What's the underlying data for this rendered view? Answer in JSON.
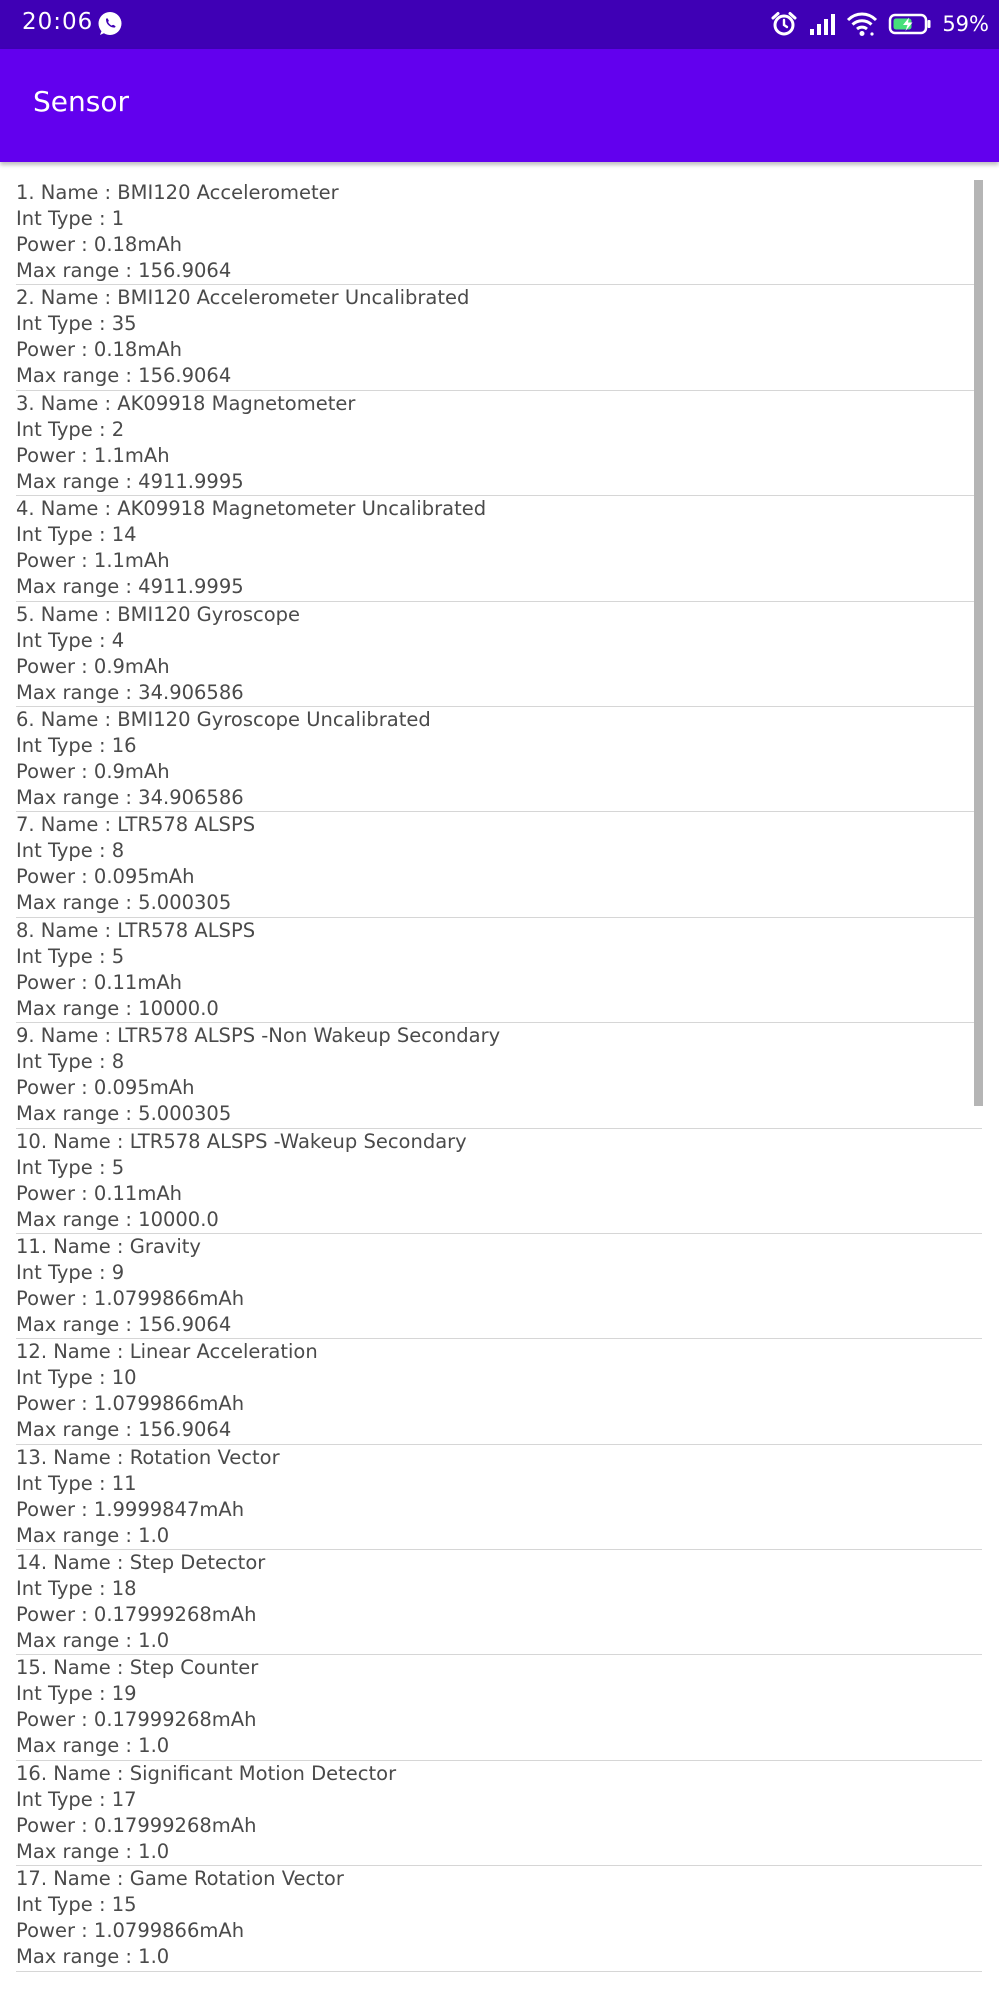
{
  "status_bar": {
    "time": "20:06",
    "battery_percent": "59%"
  },
  "app_bar": {
    "title": "Sensor"
  },
  "sensors": [
    {
      "index": "1",
      "name": "BMI120 Accelerometer",
      "int_type": "1",
      "power": "0.18mAh",
      "max_range": "156.9064"
    },
    {
      "index": "2",
      "name": "BMI120 Accelerometer Uncalibrated",
      "int_type": "35",
      "power": "0.18mAh",
      "max_range": "156.9064"
    },
    {
      "index": "3",
      "name": "AK09918 Magnetometer",
      "int_type": "2",
      "power": "1.1mAh",
      "max_range": "4911.9995"
    },
    {
      "index": "4",
      "name": "AK09918 Magnetometer Uncalibrated",
      "int_type": "14",
      "power": "1.1mAh",
      "max_range": "4911.9995"
    },
    {
      "index": "5",
      "name": "BMI120 Gyroscope",
      "int_type": "4",
      "power": "0.9mAh",
      "max_range": "34.906586"
    },
    {
      "index": "6",
      "name": "BMI120 Gyroscope Uncalibrated",
      "int_type": "16",
      "power": "0.9mAh",
      "max_range": "34.906586"
    },
    {
      "index": "7",
      "name": "LTR578 ALSPS",
      "int_type": "8",
      "power": "0.095mAh",
      "max_range": "5.000305"
    },
    {
      "index": "8",
      "name": "LTR578 ALSPS",
      "int_type": "5",
      "power": "0.11mAh",
      "max_range": "10000.0"
    },
    {
      "index": "9",
      "name": "LTR578 ALSPS -Non Wakeup Secondary",
      "int_type": "8",
      "power": "0.095mAh",
      "max_range": "5.000305"
    },
    {
      "index": "10",
      "name": "LTR578 ALSPS -Wakeup Secondary",
      "int_type": "5",
      "power": "0.11mAh",
      "max_range": "10000.0"
    },
    {
      "index": "11",
      "name": "Gravity",
      "int_type": "9",
      "power": "1.0799866mAh",
      "max_range": "156.9064"
    },
    {
      "index": "12",
      "name": "Linear Acceleration",
      "int_type": "10",
      "power": "1.0799866mAh",
      "max_range": "156.9064"
    },
    {
      "index": "13",
      "name": "Rotation Vector",
      "int_type": "11",
      "power": "1.9999847mAh",
      "max_range": "1.0"
    },
    {
      "index": "14",
      "name": "Step Detector",
      "int_type": "18",
      "power": "0.17999268mAh",
      "max_range": "1.0"
    },
    {
      "index": "15",
      "name": "Step Counter",
      "int_type": "19",
      "power": "0.17999268mAh",
      "max_range": "1.0"
    },
    {
      "index": "16",
      "name": "Significant Motion Detector",
      "int_type": "17",
      "power": "0.17999268mAh",
      "max_range": "1.0"
    },
    {
      "index": "17",
      "name": "Game Rotation Vector",
      "int_type": "15",
      "power": "1.0799866mAh",
      "max_range": "1.0"
    }
  ],
  "colors": {
    "status_bar": "#3f00b5",
    "app_bar": "#6200ee",
    "text": "#4a4a4a",
    "divider": "#d6d6d6"
  },
  "icons": {
    "notification": "whatsapp-icon",
    "alarm": "alarm-icon",
    "signal": "signal-icon",
    "wifi": "wifi-icon",
    "battery": "battery-charging-icon"
  }
}
